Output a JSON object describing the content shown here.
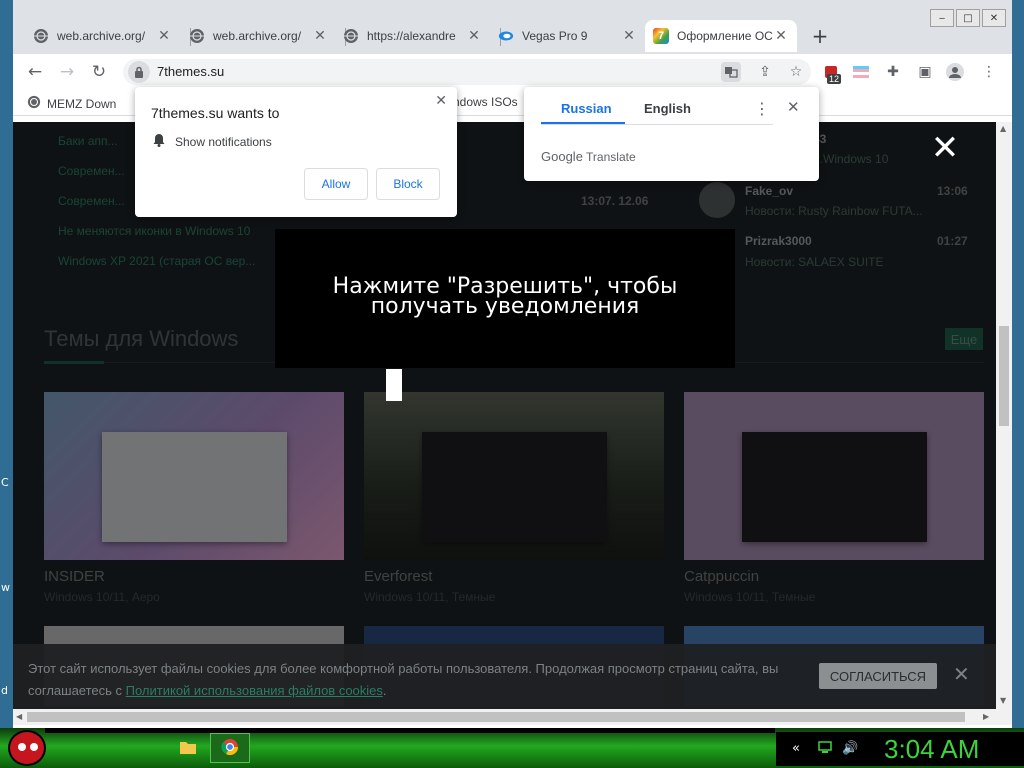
{
  "desktop": {
    "left_chars": [
      "C",
      "w",
      "d"
    ]
  },
  "window": {
    "controls": [
      "‒",
      "□",
      "✕"
    ]
  },
  "tabs": [
    {
      "title": "web.archive.org/",
      "icon": "globe-icon"
    },
    {
      "title": "web.archive.org/",
      "icon": "globe-icon"
    },
    {
      "title": "https://alexandre",
      "icon": "globe-icon"
    },
    {
      "title": "Vegas Pro 9",
      "icon": "vegas-icon"
    },
    {
      "title": "Оформление ОС",
      "icon": "7themes-icon",
      "active": true
    }
  ],
  "toolbar": {
    "url": "7themes.su",
    "ext_badge": "12"
  },
  "bookmarks": [
    {
      "label": "MEMZ Down",
      "icon": "globe-icon"
    },
    {
      "label": "Windows ISOs",
      "icon": "windows-icon"
    }
  ],
  "notification_prompt": {
    "title": "7themes.su wants to",
    "permission": "Show notifications",
    "allow": "Allow",
    "block": "Block"
  },
  "translate_popup": {
    "lang_source": "Russian",
    "lang_target": "English",
    "brand_google": "Google",
    "brand_translate": "Translate"
  },
  "overlay": {
    "line1": "Нажмите \"Разрешить\", чтобы",
    "line2": "получать уведомления"
  },
  "page": {
    "news": [
      {
        "title": "Баки апп...",
        "time": ""
      },
      {
        "title": "Современ...",
        "time": ""
      },
      {
        "title": "Современ...",
        "time": "13:07. 12.06"
      },
      {
        "title": "Не меняются иконки в Windows 10",
        "time": ""
      },
      {
        "title": "Windows XP 2021 (старая ОС вер...",
        "time": ""
      }
    ],
    "comments": [
      {
        "user": "...43",
        "sub": "...Windows 10",
        "time": ""
      },
      {
        "user": "Fake_ov",
        "sub": "Новости: Rusty Rainbow FUTA...",
        "time": "13:06"
      },
      {
        "user": "Prizrak3000",
        "sub": "Новости: SALAEX SUITE",
        "time": "01:27"
      }
    ],
    "section_title": "Темы для Windows",
    "more_button": "Еще",
    "themes": [
      {
        "name": "INSIDER",
        "sub": "Windows 10/11, Аеро"
      },
      {
        "name": "Everforest",
        "sub": "Windows 10/11, Темные"
      },
      {
        "name": "Catppuccin",
        "sub": "Windows 10/11, Темные"
      }
    ]
  },
  "cookie_bar": {
    "text": "Этот сайт использует файлы cookies для более комфортной работы пользователя. Продолжая просмотр страниц сайта, вы соглашаетесь с ",
    "link": "Политикой использования файлов cookies",
    "text_end": ".",
    "accept": "СОГЛАСИТЬСЯ",
    "close": "✕"
  },
  "taskbar": {
    "clock": "3:04 AM"
  },
  "colors": {
    "accent_blue": "#1a73e8",
    "site_green": "#2b7d63",
    "taskbar_green": "#23a81f",
    "clock_green": "#3bd43b"
  }
}
